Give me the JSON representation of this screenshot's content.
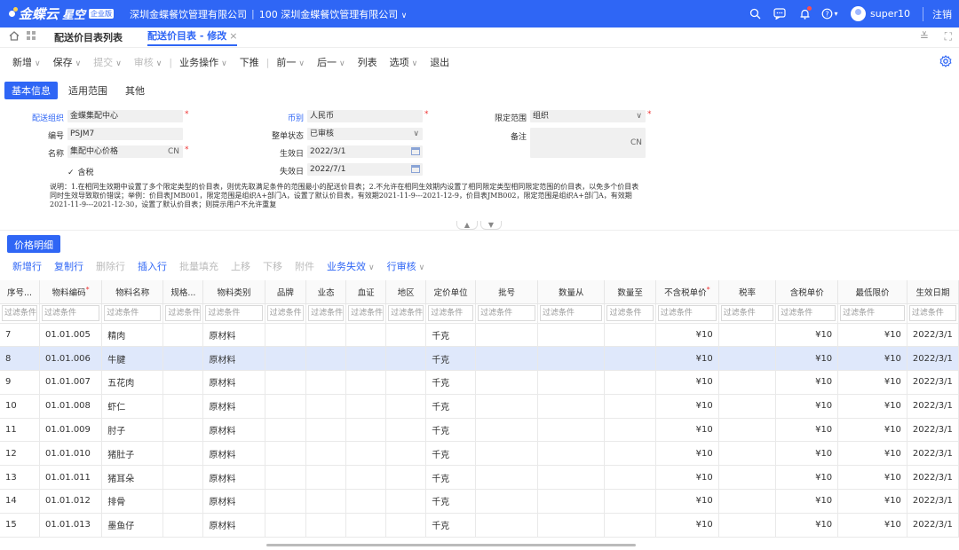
{
  "topbar": {
    "brand": "金蝶云",
    "sub": "星空",
    "tag": "企业版",
    "company": "深圳金蝶餐饮管理有限公司",
    "org": "100 深圳金蝶餐饮管理有限公司",
    "username": "super10",
    "logout": "注销"
  },
  "tabs": {
    "list_tab": "配送价目表列表",
    "edit_tab": "配送价目表 - 修改"
  },
  "toolbar": {
    "new": "新增",
    "save": "保存",
    "submit": "提交",
    "audit": "审核",
    "business": "业务操作",
    "push": "下推",
    "prev": "前一",
    "next": "后一",
    "list": "列表",
    "options": "选项",
    "exit": "退出"
  },
  "formtabs": [
    "基本信息",
    "适用范围",
    "其他"
  ],
  "form": {
    "org_label": "配送组织",
    "org_value": "金蝶集配中心",
    "code_label": "编号",
    "code_value": "PSJM7",
    "name_label": "名称",
    "name_value": "集配中心价格",
    "name_suffix": "CN",
    "currency_label": "币别",
    "currency_value": "人民币",
    "status_label": "整单状态",
    "status_value": "已审核",
    "eff_label": "生效日",
    "eff_value": "2022/3/1",
    "exp_label": "失效日",
    "exp_value": "2022/7/1",
    "range_label": "限定范围",
    "range_value": "组织",
    "remark_label": "备注",
    "remark_suffix": "CN",
    "tax_label": "含税",
    "note": "说明：1.在相同生效期中设置了多个限定类型的价目表，则优先取满足条件的范围最小的配送价目表；2.不允许在相同生效期内设置了相同限定类型相同限定范围的价目表，以免多个价目表同时生效导致取价错误；举例：价目表JMB001，限定范围是组织A+部门A，设置了默认价目表，有效期2021-11-9---2021-12-9，价目表JMB002，限定范围是组织A+部门A，有效期2021-11-9---2021-12-30，设置了默认价目表；则提示用户不允许重复"
  },
  "detail": {
    "tab": "价格明细",
    "tools": {
      "add_row": "新增行",
      "copy_row": "复制行",
      "del_row": "删除行",
      "insert_row": "插入行",
      "batch_fill": "批量填充",
      "up": "上移",
      "down": "下移",
      "attach": "附件",
      "biz_invalid": "业务失效",
      "row_audit": "行审核"
    },
    "columns": [
      "序号...",
      "物料编码",
      "物料名称",
      "规格...",
      "物料类别",
      "品牌",
      "业态",
      "血证",
      "地区",
      "定价单位",
      "批号",
      "数量从",
      "数量至",
      "不含税单价",
      "税率",
      "含税单价",
      "最低限价",
      "生效日期"
    ],
    "filter_text": "过滤条件",
    "rows": [
      {
        "seq": "7",
        "code": "01.01.005",
        "name": "精肉",
        "cat": "原材料",
        "unit": "千克",
        "price": "¥10",
        "tax_price": "¥10",
        "min_price": "¥10",
        "date": "2022/3/1"
      },
      {
        "seq": "8",
        "code": "01.01.006",
        "name": "牛腱",
        "cat": "原材料",
        "unit": "千克",
        "price": "¥10",
        "tax_price": "¥10",
        "min_price": "¥10",
        "date": "2022/3/1"
      },
      {
        "seq": "9",
        "code": "01.01.007",
        "name": "五花肉",
        "cat": "原材料",
        "unit": "千克",
        "price": "¥10",
        "tax_price": "¥10",
        "min_price": "¥10",
        "date": "2022/3/1"
      },
      {
        "seq": "10",
        "code": "01.01.008",
        "name": "虾仁",
        "cat": "原材料",
        "unit": "千克",
        "price": "¥10",
        "tax_price": "¥10",
        "min_price": "¥10",
        "date": "2022/3/1"
      },
      {
        "seq": "11",
        "code": "01.01.009",
        "name": "肘子",
        "cat": "原材料",
        "unit": "千克",
        "price": "¥10",
        "tax_price": "¥10",
        "min_price": "¥10",
        "date": "2022/3/1"
      },
      {
        "seq": "12",
        "code": "01.01.010",
        "name": "猪肚子",
        "cat": "原材料",
        "unit": "千克",
        "price": "¥10",
        "tax_price": "¥10",
        "min_price": "¥10",
        "date": "2022/3/1"
      },
      {
        "seq": "13",
        "code": "01.01.011",
        "name": "猪耳朵",
        "cat": "原材料",
        "unit": "千克",
        "price": "¥10",
        "tax_price": "¥10",
        "min_price": "¥10",
        "date": "2022/3/1"
      },
      {
        "seq": "14",
        "code": "01.01.012",
        "name": "排骨",
        "cat": "原材料",
        "unit": "千克",
        "price": "¥10",
        "tax_price": "¥10",
        "min_price": "¥10",
        "date": "2022/3/1"
      },
      {
        "seq": "15",
        "code": "01.01.013",
        "name": "墨鱼仔",
        "cat": "原材料",
        "unit": "千克",
        "price": "¥10",
        "tax_price": "¥10",
        "min_price": "¥10",
        "date": "2022/3/1"
      }
    ],
    "selected_seq": "8"
  },
  "colors": {
    "accent": "#2f66f5",
    "selected_row": "#dfe8fb"
  }
}
